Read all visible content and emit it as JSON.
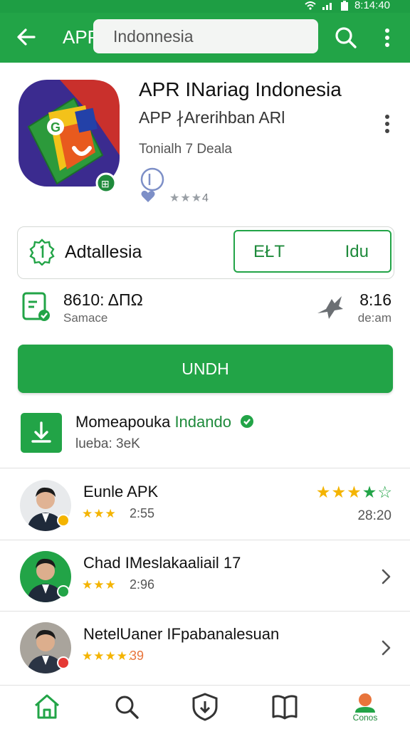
{
  "status_bar": {
    "time": "8:14:40"
  },
  "appbar": {
    "title": "APP",
    "search_value": "Indonnesia",
    "back_icon": "arrow-left-icon",
    "search_icon": "search-icon",
    "more_icon": "more-vertical-icon"
  },
  "app": {
    "name": "APR INariag Indonesia",
    "developer": "APP ∤Arerihban  ARl",
    "meta": "Tonialh 7 Deala",
    "rating_count": "4"
  },
  "install_card": {
    "label": "Adtallesia",
    "left_option": "EŁT",
    "right_option": "Idu"
  },
  "stats": {
    "left_value": "8610: ΔΠΩ",
    "left_label": "Samace",
    "right_value": "8:16",
    "right_label": "de:am"
  },
  "install_button": {
    "label": "UNDH"
  },
  "download": {
    "title": "Momeapouka",
    "title_accent": "Indando",
    "subtitle": "lueba: 3eK"
  },
  "reviews": [
    {
      "name": "Eunle APK",
      "stars": "★★★",
      "score": "2:55",
      "right_stars": "★★★★☆",
      "right_time": "28:20",
      "badge_color": "#f4b400"
    },
    {
      "name": "Chad IMeslakaaliail 17",
      "stars": "★★★",
      "score": "2:96",
      "badge_color": "#22a447"
    },
    {
      "name": "NetelUaner IFpabanalesuan",
      "stars": "★★★★:",
      "score": "39",
      "badge_color": "#e53935"
    }
  ],
  "bottom_nav": {
    "items": [
      "home-icon",
      "search-icon",
      "download-shield-icon",
      "book-icon",
      "profile-icon"
    ],
    "active_label": "Conos"
  },
  "colors": {
    "primary": "#22a447",
    "primary_dark": "#1e8a3b",
    "star": "#f4b400"
  }
}
